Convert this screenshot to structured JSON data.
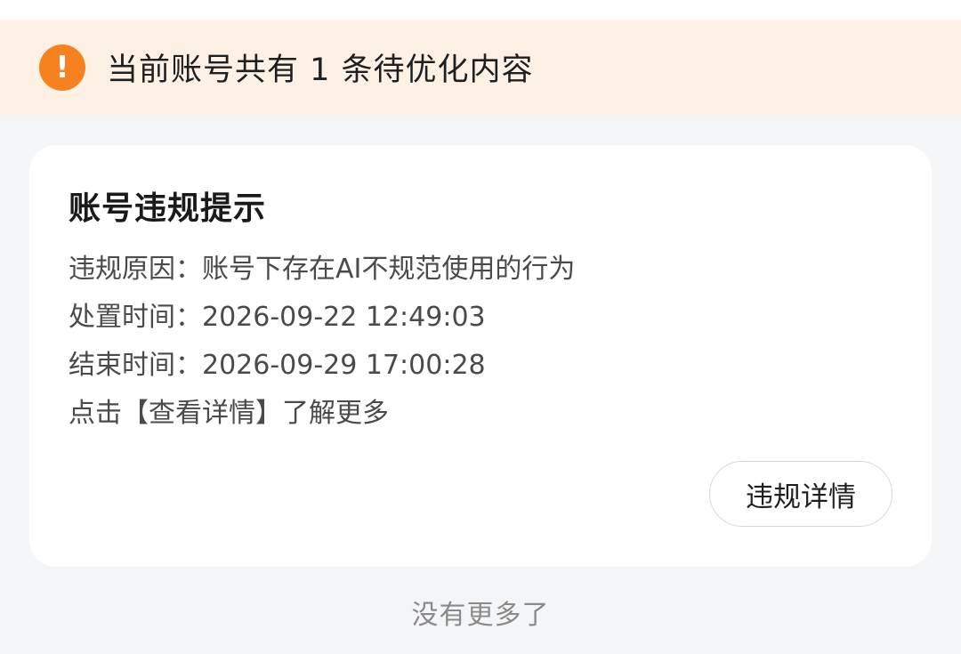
{
  "notice": {
    "icon": "exclamation-icon",
    "icon_glyph": "!",
    "text": "当前账号共有 1 条待优化内容",
    "accent_color": "#f5821f",
    "background_color": "#fdf1e6"
  },
  "card": {
    "title": "账号违规提示",
    "reason": "违规原因：账号下存在AI不规范使用的行为",
    "handled_time": "处置时间：2026-09-22 12:49:03",
    "end_time": "结束时间：2026-09-29 17:00:28",
    "hint": "点击【查看详情】了解更多",
    "detail_button_label": "违规详情"
  },
  "footer": {
    "no_more_text": "没有更多了"
  }
}
